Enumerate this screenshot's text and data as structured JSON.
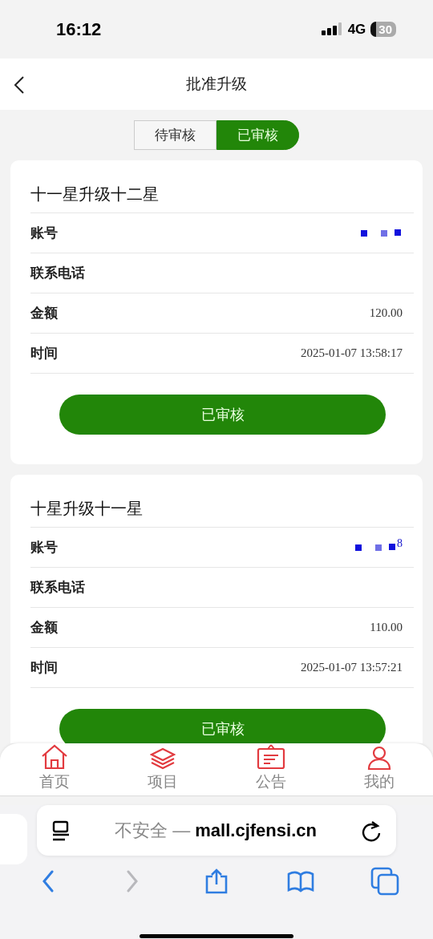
{
  "status_bar": {
    "time": "16:12",
    "network": "4G",
    "battery": "30"
  },
  "header": {
    "title": "批准升级"
  },
  "tabs": [
    {
      "label": "待审核",
      "selected": false
    },
    {
      "label": "已审核",
      "selected": true
    }
  ],
  "cards": [
    {
      "title": "十一星升级十二星",
      "fields": [
        {
          "label": "账号",
          "redacted": true
        },
        {
          "label": "联系电话"
        },
        {
          "label": "金额",
          "value": "120.00"
        },
        {
          "label": "时间",
          "value": "2025-01-07 13:58:17"
        }
      ],
      "button": "已审核"
    },
    {
      "title": "十星升级十一星",
      "fields": [
        {
          "label": "账号",
          "value": "8",
          "redacted": true
        },
        {
          "label": "联系电话"
        },
        {
          "label": "金额",
          "value": "110.00"
        },
        {
          "label": "时间",
          "value": "2025-01-07 13:57:21"
        }
      ],
      "button": "已审核"
    }
  ],
  "tab_bar": [
    {
      "kind": "home",
      "label": "首页"
    },
    {
      "kind": "layers",
      "label": "项目"
    },
    {
      "kind": "notice",
      "label": "公告"
    },
    {
      "kind": "user",
      "label": "我的"
    }
  ],
  "browser": {
    "address": "不安全 — **mall.cjfensi.cn**",
    "buttons": [
      {
        "kind": "back",
        "disabled": false
      },
      {
        "kind": "forward",
        "disabled": true
      },
      {
        "kind": "share",
        "disabled": false
      },
      {
        "kind": "bookmarks",
        "disabled": false
      },
      {
        "kind": "tabs",
        "disabled": false
      }
    ]
  }
}
